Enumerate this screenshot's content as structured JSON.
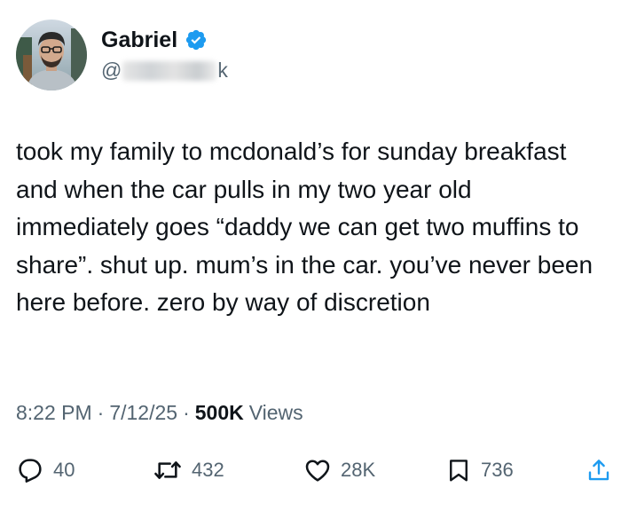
{
  "author": {
    "display_name": "Gabriel",
    "handle_prefix": "@",
    "handle_suffix": "k",
    "verified": true,
    "verified_color": "#1d9bf0"
  },
  "tweet": {
    "text": "took my family to mcdonald’s for sunday breakfast and when the car pulls in my two year old immediately goes “daddy we can get two muffins to share”. shut up. mum’s in the car. you’ve never been here before. zero by way of discretion"
  },
  "meta": {
    "time": "8:22 PM",
    "date": "7/12/25",
    "separator": "·",
    "views_count": "500K",
    "views_label": "Views"
  },
  "actions": {
    "reply": {
      "icon": "reply-icon",
      "count": "40"
    },
    "repost": {
      "icon": "repost-icon",
      "count": "432"
    },
    "like": {
      "icon": "heart-icon",
      "count": "28K"
    },
    "bookmark": {
      "icon": "bookmark-icon",
      "count": "736"
    },
    "share": {
      "icon": "share-icon"
    }
  },
  "colors": {
    "text_primary": "#0f1419",
    "text_secondary": "#536471",
    "verified": "#1d9bf0"
  }
}
